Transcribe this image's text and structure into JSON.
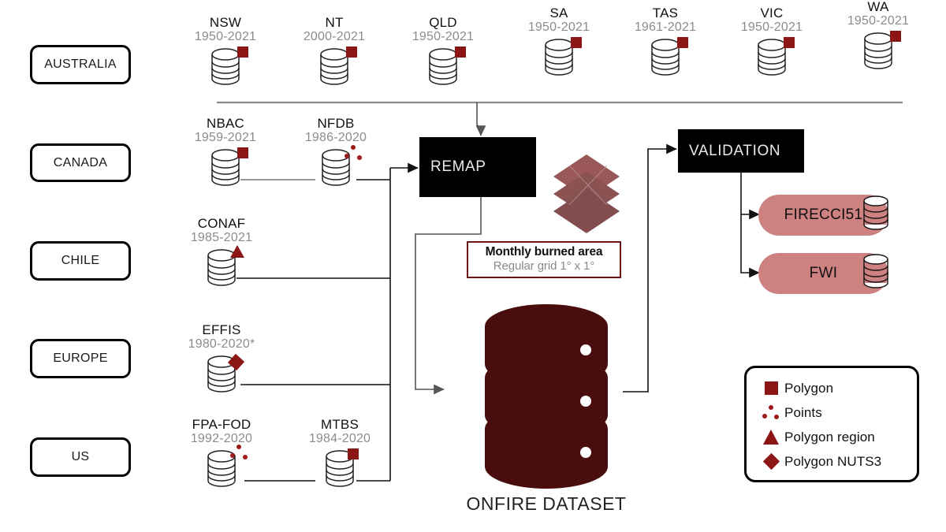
{
  "regions": [
    {
      "label": "AUSTRALIA"
    },
    {
      "label": "CANADA"
    },
    {
      "label": "CHILE"
    },
    {
      "label": "EUROPE"
    },
    {
      "label": "US"
    }
  ],
  "sources": {
    "australia": [
      {
        "name": "NSW",
        "years": "1950-2021",
        "marker": "polygon"
      },
      {
        "name": "NT",
        "years": "2000-2021",
        "marker": "polygon"
      },
      {
        "name": "QLD",
        "years": "1950-2021",
        "marker": "polygon"
      },
      {
        "name": "SA",
        "years": "1950-2021",
        "marker": "polygon"
      },
      {
        "name": "TAS",
        "years": "1961-2021",
        "marker": "polygon"
      },
      {
        "name": "VIC",
        "years": "1950-2021",
        "marker": "polygon"
      },
      {
        "name": "WA",
        "years": "1950-2021",
        "marker": "polygon"
      }
    ],
    "canada": [
      {
        "name": "NBAC",
        "years": "1959-2021",
        "marker": "polygon"
      },
      {
        "name": "NFDB",
        "years": "1986-2020",
        "marker": "points"
      }
    ],
    "chile": [
      {
        "name": "CONAF",
        "years": "1985-2021",
        "marker": "polygon-region"
      }
    ],
    "europe": [
      {
        "name": "EFFIS",
        "years": "1980-2020*",
        "marker": "polygon-nuts3"
      }
    ],
    "us": [
      {
        "name": "FPA-FOD",
        "years": "1992-2020",
        "marker": "points"
      },
      {
        "name": "MTBS",
        "years": "1984-2020",
        "marker": "polygon"
      }
    ]
  },
  "process": {
    "remap": "REMAP",
    "validation": "VALIDATION"
  },
  "note": {
    "title": "Monthly burned area",
    "subtitle": "Regular grid 1° x 1°"
  },
  "dataset": {
    "caption": "ONFIRE DATASET"
  },
  "validation_targets": [
    {
      "label": "FIRECCI51"
    },
    {
      "label": "FWI"
    }
  ],
  "legend": [
    {
      "icon": "polygon-square-icon",
      "label": "Polygon"
    },
    {
      "icon": "points-icon",
      "label": "Points"
    },
    {
      "icon": "polygon-triangle-icon",
      "label": "Polygon region"
    },
    {
      "icon": "polygon-diamond-icon",
      "label": "Polygon NUTS3"
    }
  ],
  "colors": {
    "marker_red": "#8c1616",
    "dataset_maroon": "#4a0d0d",
    "pill_pink": "#cd8181",
    "note_border": "#6d1414",
    "layers_red": "#7e2a2a",
    "muted_text": "#8c8c8c"
  }
}
